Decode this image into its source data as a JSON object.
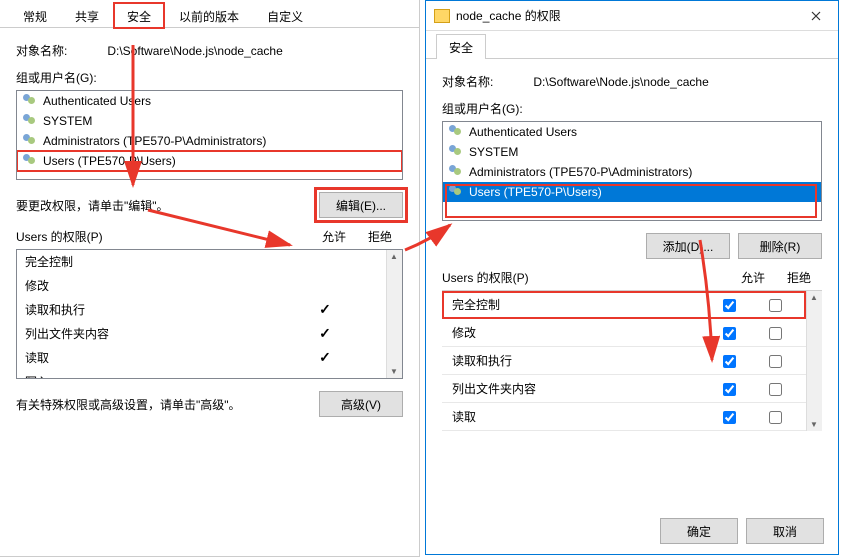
{
  "win2_title": "node_cache 的权限",
  "tabs1": {
    "t0": "常规",
    "t1": "共享",
    "t2": "安全",
    "t3": "以前的版本",
    "t4": "自定义"
  },
  "tabs2": {
    "t0": "安全"
  },
  "object_label": "对象名称:",
  "object_path": "D:\\Software\\Node.js\\node_cache",
  "group_label": "组或用户名(G):",
  "groups": {
    "g0": "Authenticated Users",
    "g1": "SYSTEM",
    "g2": "Administrators (TPE570-P\\Administrators)",
    "g3": "Users (TPE570-P\\Users)"
  },
  "edit_hint": "要更改权限，请单击\"编辑\"。",
  "btn_edit": "编辑(E)...",
  "btn_add": "添加(D)...",
  "btn_remove": "删除(R)",
  "perm_header": "Users 的权限(P)",
  "perm_allow": "允许",
  "perm_deny": "拒绝",
  "perms": {
    "p0": "完全控制",
    "p1": "修改",
    "p2": "读取和执行",
    "p3": "列出文件夹内容",
    "p4": "读取",
    "p5": "写入"
  },
  "adv_hint": "有关特殊权限或高级设置，请单击\"高级\"。",
  "btn_adv": "高级(V)",
  "btn_ok": "确定",
  "btn_cancel": "取消"
}
